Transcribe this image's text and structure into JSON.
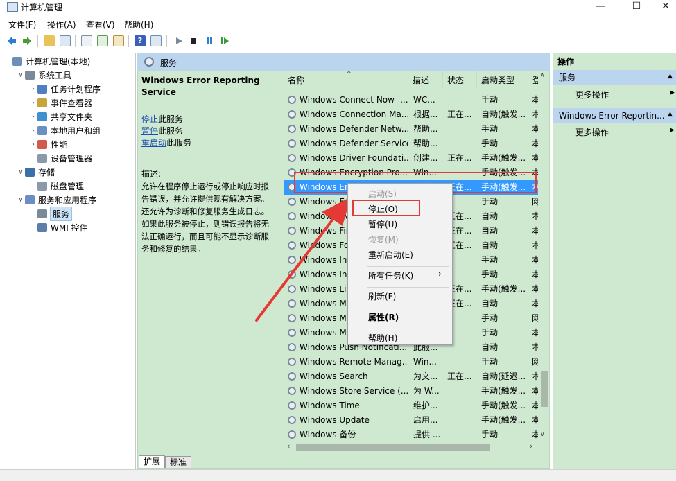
{
  "window": {
    "title": "计算机管理",
    "minimize": "—",
    "maximize": "☐",
    "close": "✕"
  },
  "menu": [
    "文件(F)",
    "操作(A)",
    "查看(V)",
    "帮助(H)"
  ],
  "tree": [
    {
      "label": "计算机管理(本地)",
      "level": 0,
      "exp": ""
    },
    {
      "label": "系统工具",
      "level": 1,
      "exp": "∨"
    },
    {
      "label": "任务计划程序",
      "level": 2,
      "exp": "›"
    },
    {
      "label": "事件查看器",
      "level": 2,
      "exp": "›"
    },
    {
      "label": "共享文件夹",
      "level": 2,
      "exp": "›"
    },
    {
      "label": "本地用户和组",
      "level": 2,
      "exp": "›"
    },
    {
      "label": "性能",
      "level": 2,
      "exp": "›"
    },
    {
      "label": "设备管理器",
      "level": 2,
      "exp": ""
    },
    {
      "label": "存储",
      "level": 1,
      "exp": "∨"
    },
    {
      "label": "磁盘管理",
      "level": 2,
      "exp": ""
    },
    {
      "label": "服务和应用程序",
      "level": 1,
      "exp": "∨"
    },
    {
      "label": "服务",
      "level": 2,
      "exp": "",
      "selected": true
    },
    {
      "label": "WMI 控件",
      "level": 2,
      "exp": ""
    }
  ],
  "center": {
    "header": "服务",
    "service_title": "Windows Error Reporting Service",
    "links": [
      {
        "link": "停止",
        "rest": "此服务"
      },
      {
        "link": "暂停",
        "rest": "此服务"
      },
      {
        "link": "重启动",
        "rest": "此服务"
      }
    ],
    "desc_label": "描述:",
    "desc_text": "允许在程序停止运行或停止响应时报告错误，并允许提供现有解决方案。还允许为诊断和修复服务生成日志。如果此服务被停止，则错误报告将无法正确运行，而且可能不显示诊断服务和修复的结果。"
  },
  "columns": [
    "名称",
    "描述",
    "状态",
    "启动类型",
    "登"
  ],
  "services": [
    {
      "name": "Windows Connect Now -...",
      "desc": "WC...",
      "status": "",
      "start": "手动",
      "logon": "本"
    },
    {
      "name": "Windows Connection Ma...",
      "desc": "根据...",
      "status": "正在...",
      "start": "自动(触发...",
      "logon": "本"
    },
    {
      "name": "Windows Defender Netw...",
      "desc": "帮助...",
      "status": "",
      "start": "手动",
      "logon": "本"
    },
    {
      "name": "Windows Defender Service",
      "desc": "帮助...",
      "status": "",
      "start": "手动",
      "logon": "本"
    },
    {
      "name": "Windows Driver Foundati...",
      "desc": "创建...",
      "status": "正在...",
      "start": "手动(触发...",
      "logon": "本"
    },
    {
      "name": "Windows Encryption Pro...",
      "desc": "Win...",
      "status": "",
      "start": "手动(触发...",
      "logon": "本"
    },
    {
      "name": "Windows Error Reporting...",
      "desc": "允许...",
      "status": "正在...",
      "start": "手动(触发...",
      "logon": "本",
      "selected": true
    },
    {
      "name": "Windows Event Collector",
      "desc": "",
      "status": "",
      "start": "手动",
      "logon": "网"
    },
    {
      "name": "Windows Event Log",
      "desc": "",
      "status": "正在...",
      "start": "自动",
      "logon": "本"
    },
    {
      "name": "Windows Firewall",
      "desc": "",
      "status": "正在...",
      "start": "自动",
      "logon": "本"
    },
    {
      "name": "Windows Font Cache Se...",
      "desc": "",
      "status": "正在...",
      "start": "自动",
      "logon": "本"
    },
    {
      "name": "Windows Image Acquisi...",
      "desc": "",
      "status": "",
      "start": "手动",
      "logon": "本"
    },
    {
      "name": "Windows Insider Service",
      "desc": "",
      "status": "",
      "start": "手动",
      "logon": "本"
    },
    {
      "name": "Windows License Manag...",
      "desc": "",
      "status": "正在...",
      "start": "手动(触发...",
      "logon": "本"
    },
    {
      "name": "Windows Management I...",
      "desc": "",
      "status": "正在...",
      "start": "自动",
      "logon": "本"
    },
    {
      "name": "Windows Media Player...",
      "desc": "",
      "status": "",
      "start": "手动",
      "logon": "网"
    },
    {
      "name": "Windows Mobile Hotspot...",
      "desc": "",
      "status": "",
      "start": "手动",
      "logon": "本"
    },
    {
      "name": "Windows Push Notificati...",
      "desc": "此服...",
      "status": "",
      "start": "自动",
      "logon": "本"
    },
    {
      "name": "Windows Remote Manag...",
      "desc": "Win...",
      "status": "",
      "start": "手动",
      "logon": "网"
    },
    {
      "name": "Windows Search",
      "desc": "为文...",
      "status": "正在...",
      "start": "自动(延迟...",
      "logon": "本"
    },
    {
      "name": "Windows Store Service (...",
      "desc": "为 W...",
      "status": "",
      "start": "手动(触发...",
      "logon": "本"
    },
    {
      "name": "Windows Time",
      "desc": "维护...",
      "status": "",
      "start": "手动(触发...",
      "logon": "本"
    },
    {
      "name": "Windows Update",
      "desc": "启用...",
      "status": "",
      "start": "手动(触发...",
      "logon": "本"
    },
    {
      "name": "Windows 备份",
      "desc": "提供 ...",
      "status": "",
      "start": "手动",
      "logon": "本"
    }
  ],
  "context_menu": [
    {
      "label": "启动(S)",
      "disabled": true
    },
    {
      "label": "停止(O)",
      "boxed": true
    },
    {
      "label": "暂停(U)"
    },
    {
      "label": "恢复(M)",
      "disabled": true
    },
    {
      "label": "重新启动(E)"
    },
    {
      "sep": true
    },
    {
      "label": "所有任务(K)",
      "submenu": true
    },
    {
      "sep": true
    },
    {
      "label": "刷新(F)"
    },
    {
      "sep": true
    },
    {
      "label": "属性(R)",
      "bold": true
    },
    {
      "sep": true
    },
    {
      "label": "帮助(H)"
    }
  ],
  "actions": {
    "title": "操作",
    "sections": [
      {
        "header": "服务",
        "item": "更多操作"
      },
      {
        "header": "Windows Error Reportin...",
        "item": "更多操作"
      }
    ]
  },
  "tabs": [
    "扩展",
    "标准"
  ],
  "colors": {
    "pane_green": "#cfe9d1",
    "header_blue": "#bcd5ef",
    "select_blue": "#3399ff",
    "highlight_red": "#e53935"
  }
}
